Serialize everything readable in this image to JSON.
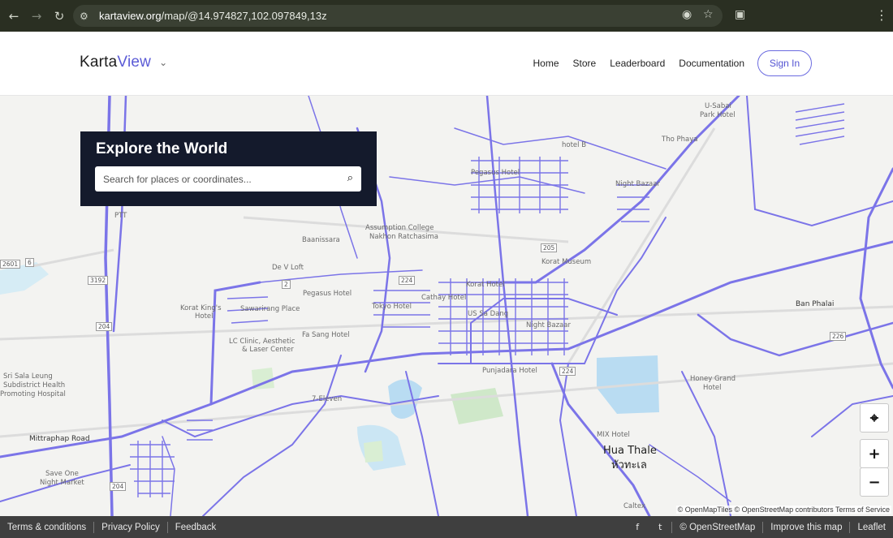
{
  "browser": {
    "url_host": "kartaview.org",
    "url_path": "/map/@14.974827,102.097849,13z"
  },
  "header": {
    "logo_part1": "Karta",
    "logo_part2": "View",
    "nav": [
      "Home",
      "Store",
      "Leaderboard",
      "Documentation"
    ],
    "signin_label": "Sign In"
  },
  "explore": {
    "title": "Explore the World",
    "search_placeholder": "Search for places or coordinates..."
  },
  "map": {
    "labels": [
      "U-Sabai",
      "Park Hotel",
      "Tho Phaya",
      "hotel B",
      "Pegasus Hotel",
      "Night Bazaar",
      "Assumption College",
      "Nakhon Ratchasima",
      "Baanissara",
      "De V Loft",
      "Korat Museum",
      "Pegasus Hotel",
      "Korat Hotel",
      "Korat King's",
      "Hotel",
      "Sawarirang Place",
      "Tokyo Hotel",
      "Cathay Hotel",
      "US Sa Dang",
      "Night Bazaar",
      "Fa Sang Hotel",
      "LC Clinic, Aesthetic",
      "& Laser Center",
      "Punjadara Hotel",
      "Sri Sala Leung",
      "Subdistrict Health",
      "Promoting Hospital",
      "7-Eleven",
      "Honey Grand",
      "Hotel",
      "Ban Phalai",
      "Mittraphap Road",
      "Save One",
      "Night Market",
      "MIX Hotel",
      "Hua Thale",
      "หัวทะเล",
      "Caltex",
      "PTT"
    ],
    "road_shields": [
      "2601",
      "6",
      "3192",
      "204",
      "2",
      "224",
      "205",
      "224",
      "226",
      "204"
    ],
    "attribution": "© OpenMapTiles © OpenStreetMap contributors Terms of Service"
  },
  "controls": {
    "locate_icon": "crosshair-icon",
    "zoom_in": "+",
    "zoom_out": "−"
  },
  "footer": {
    "left_links": [
      "Terms & conditions",
      "Privacy Policy",
      "Feedback"
    ],
    "social": [
      "f",
      "t"
    ],
    "right_links": [
      "© OpenStreetMap",
      "Improve this map",
      "Leaflet"
    ]
  }
}
